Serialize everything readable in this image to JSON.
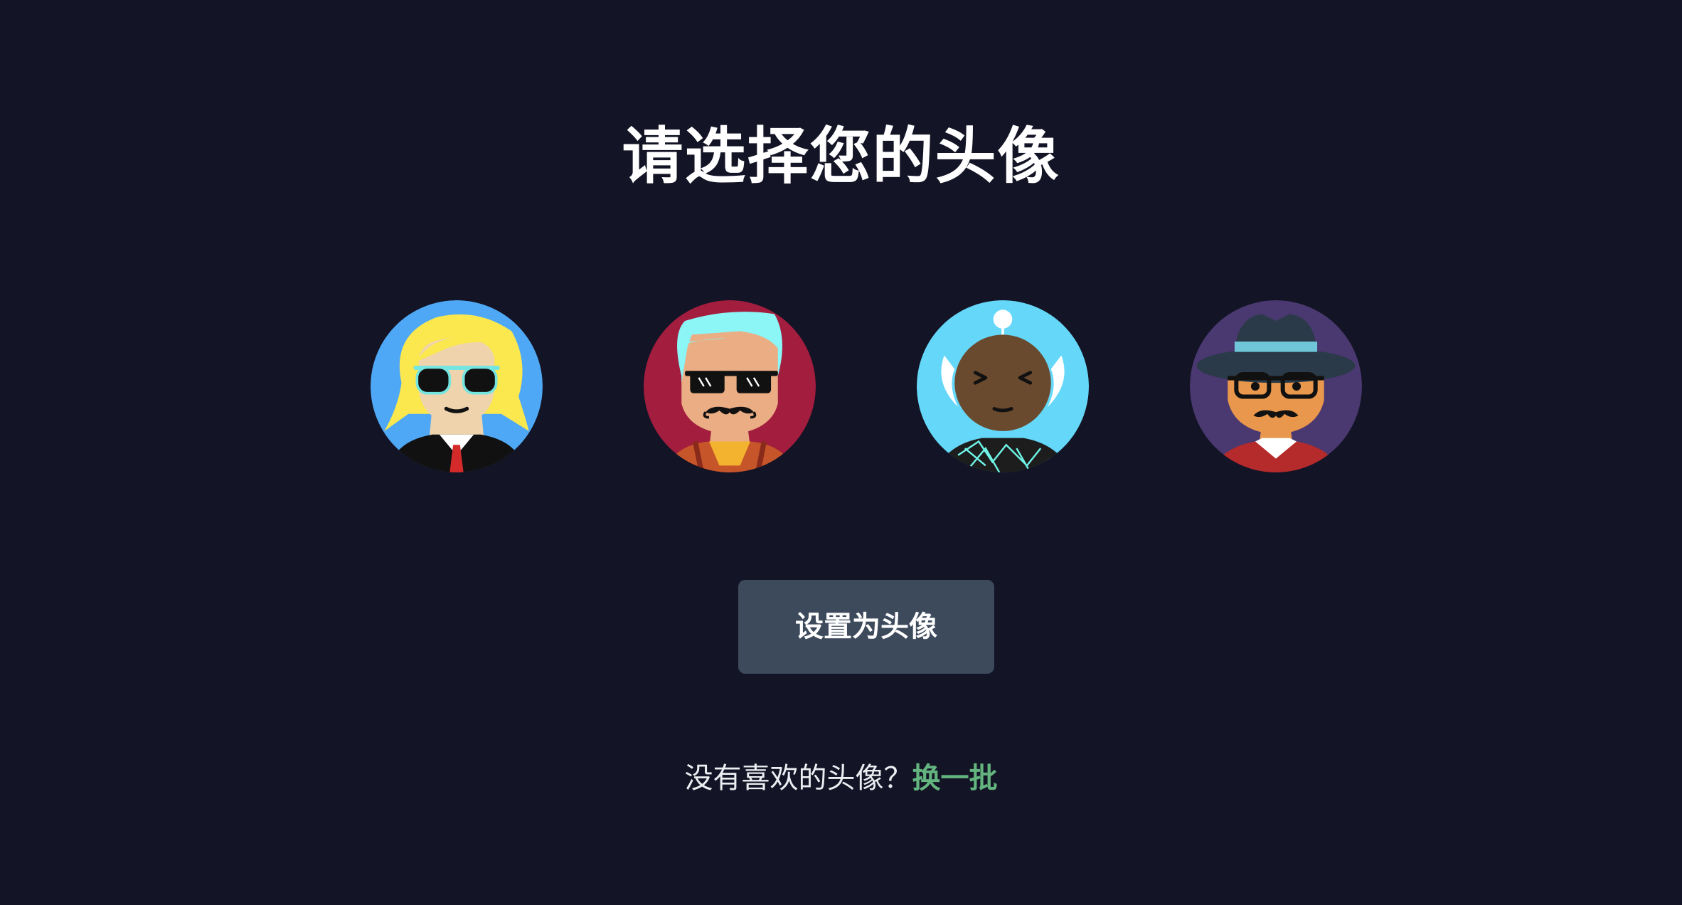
{
  "page": {
    "title": "请选择您的头像",
    "background": "#131425"
  },
  "avatars": [
    {
      "name": "avatar-blonde-sunglasses",
      "background": "#4fa8f5"
    },
    {
      "name": "avatar-cyan-hair-mustache",
      "background": "#a31d3e"
    },
    {
      "name": "avatar-dark-antenna-alien",
      "background": "#65d7f9"
    },
    {
      "name": "avatar-fedora-glasses-mustache",
      "background": "#4a3870"
    }
  ],
  "actions": {
    "set_avatar_label": "设置为头像",
    "button_color": "#3d4a5c"
  },
  "footer": {
    "prompt": "没有喜欢的头像？",
    "refresh_label": "换一批",
    "refresh_color": "#63b47e"
  }
}
